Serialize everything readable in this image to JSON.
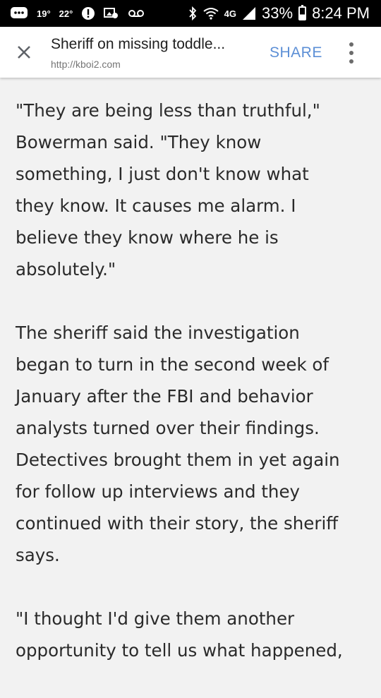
{
  "status_bar": {
    "temp_1": "19°",
    "temp_2": "22°",
    "network": "4G",
    "battery": "33%",
    "time": "8:24 PM"
  },
  "toolbar": {
    "title": "Sheriff on missing toddle...",
    "url": "http://kboi2.com",
    "share_label": "SHARE"
  },
  "article": {
    "paragraphs": [
      "\"They are being less than truthful,\"\nBowerman said. \"They know\nsomething, I just don't know what\nthey know. It causes me alarm. I\nbelieve they know where he is\nabsolutely.\"",
      "The sheriff said the investigation\nbegan to turn in the second week of\nJanuary after the FBI and behavior\nanalysts turned over their findings.\nDetectives brought them in yet again\nfor follow up interviews and they\ncontinued with their story, the sheriff\nsays.",
      "\"I thought I'd give them another\nopportunity to tell us what happened,"
    ]
  }
}
